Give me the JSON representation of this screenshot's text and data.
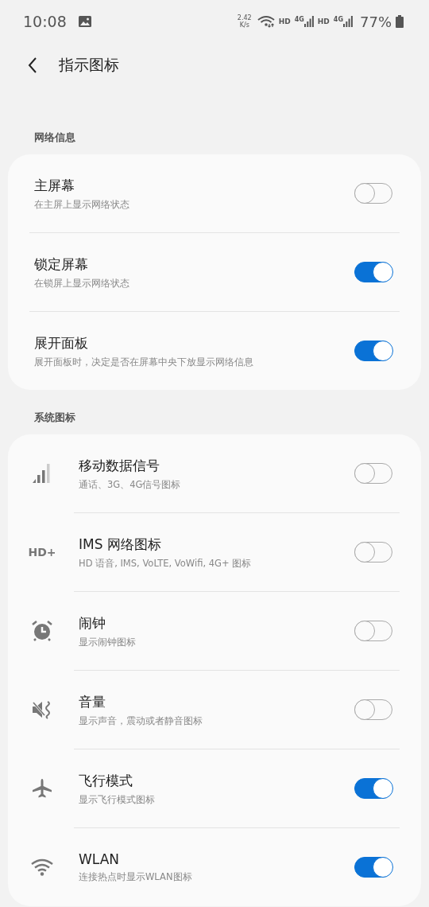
{
  "status_bar": {
    "time": "10:08",
    "speed_value": "2.42",
    "speed_unit": "K/s",
    "sim_1_label": "HD",
    "sim_1_network": "4G",
    "sim_2_label": "HD",
    "sim_2_network": "4G",
    "battery": "77%"
  },
  "header": {
    "title": "指示图标"
  },
  "sections": [
    {
      "title": "网络信息",
      "items": [
        {
          "title": "主屏幕",
          "subtitle": "在主屏上显示网络状态",
          "on": false
        },
        {
          "title": "锁定屏幕",
          "subtitle": "在锁屏上显示网络状态",
          "on": true
        },
        {
          "title": "展开面板",
          "subtitle": "展开面板时，决定是否在屏幕中央下放显示网络信息",
          "on": true
        }
      ]
    },
    {
      "title": "系统图标",
      "items": [
        {
          "kind": "signal",
          "title": "移动数据信号",
          "subtitle": "通话、3G、4G信号图标",
          "on": false
        },
        {
          "kind": "text",
          "icon_text": "HD+",
          "title": "IMS 网络图标",
          "subtitle": "HD 语音, IMS, VoLTE, VoWifi, 4G+ 图标",
          "on": false
        },
        {
          "kind": "alarm",
          "title": "闹钟",
          "subtitle": "显示闹钟图标",
          "on": false
        },
        {
          "kind": "mute",
          "title": "音量",
          "subtitle": "显示声音，震动或者静音图标",
          "on": false
        },
        {
          "kind": "airplane",
          "title": "飞行模式",
          "subtitle": "显示飞行模式图标",
          "on": true
        },
        {
          "kind": "wifi",
          "title": "WLAN",
          "subtitle": "连接热点时显示WLAN图标",
          "on": true
        }
      ]
    }
  ]
}
